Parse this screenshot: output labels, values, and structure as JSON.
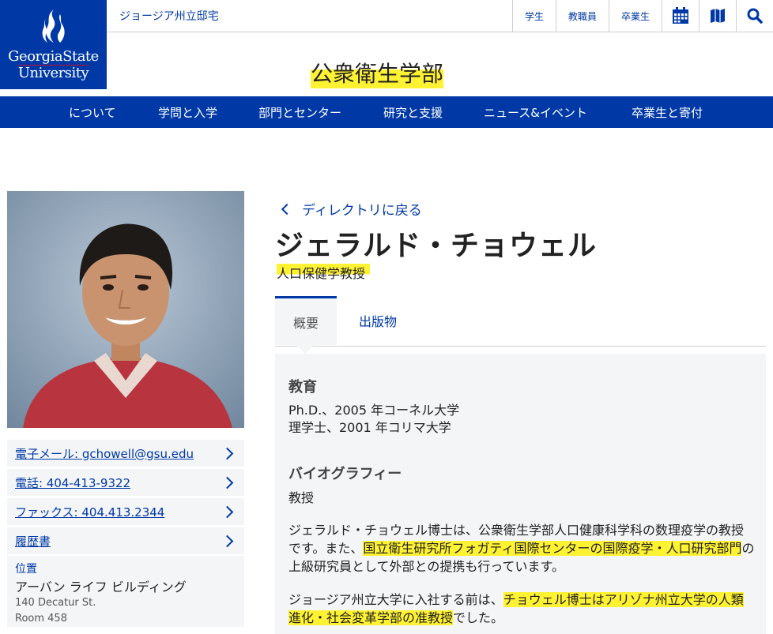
{
  "header": {
    "logo_line1": "GeorgiaState",
    "logo_line2": "University",
    "parent_link": "ジョージア州立邸宅",
    "util_links": [
      "学生",
      "教職員",
      "卒業生"
    ],
    "util_icons": [
      "calendar-icon",
      "map-icon",
      "search-icon"
    ],
    "site_title": "公衆衛生学部"
  },
  "nav": {
    "items": [
      "について",
      "学問と入学",
      "部門とセンター",
      "研究と支援",
      "ニュース&イベント",
      "卒業生と寄付"
    ]
  },
  "contact": {
    "email": "電子メール: gchowell@gsu.edu",
    "phone": "電話: 404-413-9322",
    "fax": "ファックス: 404.413.2344",
    "cv": "履歴書",
    "location_label": "位置",
    "building": "アーバン ライフ ビルディング",
    "street": "140 Decatur St.",
    "room": "Room 458"
  },
  "profile": {
    "back_link": "ディレクトリに戻る",
    "name": "ジェラルド・チョウェル",
    "title": "人口保健学教授",
    "tabs": [
      "概要",
      "出版物"
    ]
  },
  "overview": {
    "education_heading": "教育",
    "education": [
      "Ph.D.、2005 年コーネル大学",
      "理学士、2001 年コリマ大学"
    ],
    "bio_heading": "バイオグラフィー",
    "bio_rank": "教授",
    "bio_p1_a": "ジェラルド・チョウェル博士は、公衆衛生学部人口健康科学科の数理疫学の教授です。また、",
    "bio_p1_b": "国立衛生研究所フォガティ国際センターの国際疫学・人口研究部門",
    "bio_p1_c": "の上級研究員として外部との提携も行っています。",
    "bio_p2_a": "ジョージア州立大学に入社する前は、",
    "bio_p2_b": "チョウェル博士はアリゾナ州立大学の人類進化・社会変革学部の准教授",
    "bio_p2_c": "でした。"
  }
}
